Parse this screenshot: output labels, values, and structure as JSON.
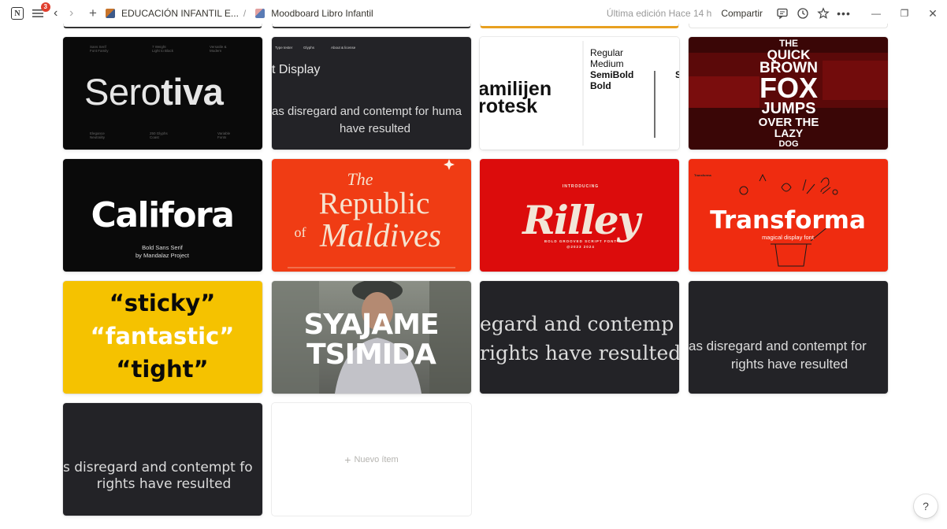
{
  "topbar": {
    "notification_count": "3",
    "breadcrumb_1": "EDUCACIÓN INFANTIL E...",
    "separator": "/",
    "breadcrumb_2": "Moodboard Libro Infantil",
    "last_edited": "Última edición Hace 14 h",
    "share_label": "Compartir"
  },
  "cards": {
    "serotiva": {
      "title_light": "Sero",
      "title_bold": "tiva",
      "top_labels": [
        [
          "Sans Serif",
          "Font Family"
        ],
        [
          "7 Weight",
          "Light to Black"
        ],
        [
          "Versatile &",
          "Modern"
        ]
      ],
      "bottom_labels": [
        [
          "Elegance",
          "Neutrality"
        ],
        [
          "250 Glyphs",
          "Coast"
        ],
        [
          "Variable",
          "Fonts"
        ]
      ]
    },
    "display_font": {
      "nav": [
        "Type tester",
        "Glyphs",
        "About & license"
      ],
      "heading": "t Display",
      "line1": "as disregard and contempt for huma",
      "line2": "have resulted"
    },
    "familijen": {
      "line1": "amilijen",
      "line2": "rotesk",
      "weights": [
        "Regular",
        "Medium",
        "SemiBold",
        "Bold"
      ],
      "edge_letter": "S"
    },
    "quick_fox": {
      "lines": [
        "THE",
        "QUICK",
        "BROWN",
        "FOX",
        "JUMPS",
        "OVER THE",
        "LAZY",
        "DOG"
      ]
    },
    "califora": {
      "title": "Califora",
      "sub1": "Bold Sans Serif",
      "sub2": "by Mandalaz Project"
    },
    "maldives": {
      "the": "The",
      "republic": "Republic",
      "of": "of",
      "maldives": "Maldives"
    },
    "rilley": {
      "intro": "INTRODUCING",
      "title": "Rilley",
      "sub1": "BOLD GROOVED SCRIPT FONT",
      "sub2": "@2023 2024"
    },
    "transforma": {
      "title": "Transforma",
      "sub": "magical display font",
      "corner": "Transforma"
    },
    "sticky": {
      "line1": "“sticky”",
      "line2": "“fantastic”",
      "line3": "“tight”"
    },
    "syjame": {
      "line1": "SYAJAME",
      "line2": "TSIMIDA"
    },
    "sample3": {
      "line1": "egard and contemp",
      "line2": "rights have resulted"
    },
    "sample4": {
      "line1": "as disregard and contempt for",
      "line2": "rights have resulted"
    },
    "sample5": {
      "line1": "s disregard and contempt fo",
      "line2": "rights have resulted"
    },
    "new_item": {
      "label": "Nuevo ítem"
    }
  },
  "help": {
    "label": "?"
  },
  "colors": {
    "dark": "#0a0a0a",
    "dark_gray": "#232327",
    "orange": "#f03c14",
    "red": "#dc0c0c",
    "yellow": "#f5c200",
    "cream": "#f2e6d8"
  }
}
